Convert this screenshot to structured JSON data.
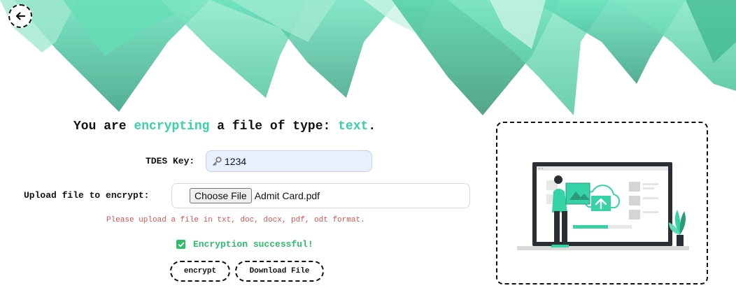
{
  "header": {
    "back_icon": "arrow-left-icon"
  },
  "heading": {
    "part1": "You are",
    "action": "encrypting",
    "part2": "a file of type:",
    "file_type": "text",
    "suffix": ".",
    "accent_color": "#35d3a6"
  },
  "form": {
    "key_label": "TDES Key:",
    "key_icon": "key-icon",
    "key_value": "1234",
    "upload_label": "Upload file to encrypt:",
    "choose_file_label": "Choose File",
    "file_name": "Admit Card.pdf",
    "hint": "Please upload a file in txt, doc, docx, pdf, odt format.",
    "hint_color": "#e0504a"
  },
  "status": {
    "icon": "checkbox-checked-icon",
    "message": "Encryption successful!",
    "color": "#2ebd6b"
  },
  "actions": {
    "encrypt_label": "encrypt",
    "download_label": "Download File"
  },
  "illustration": {
    "name": "file-upload-illustration",
    "palette": [
      "#35d3a6",
      "#2a2f33",
      "#e8e8e8"
    ]
  },
  "theme": {
    "banner_colors": [
      "#35d3a6",
      "#5fdcb4",
      "#2a9b7a",
      "#a3ead3"
    ]
  }
}
